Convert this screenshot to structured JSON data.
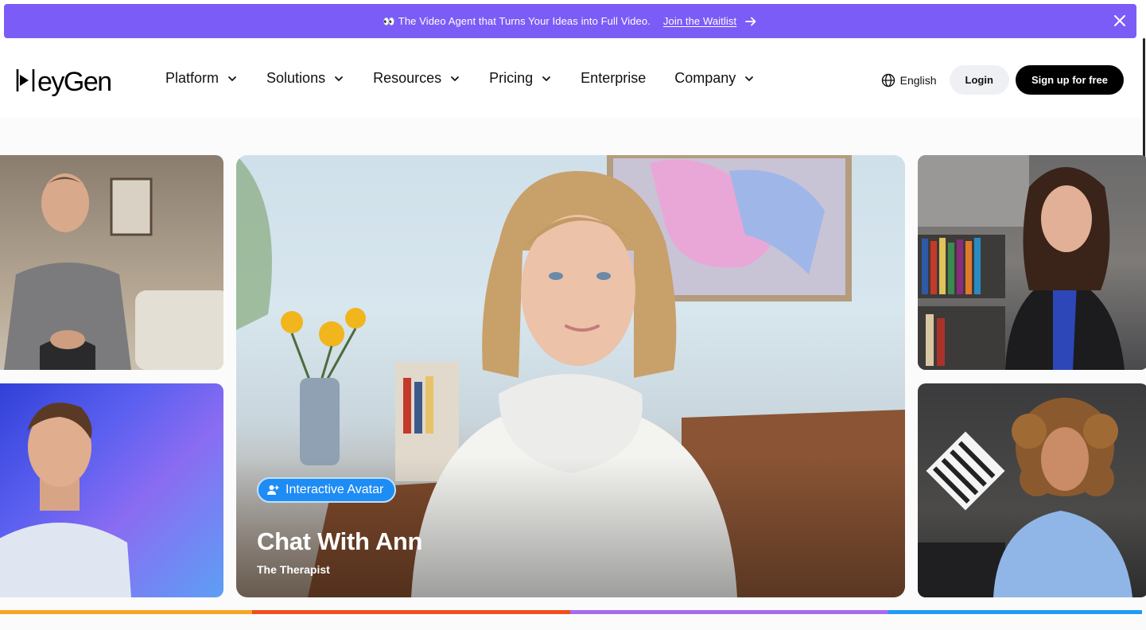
{
  "banner": {
    "emoji": "👀",
    "message": "The Video Agent that Turns Your Ideas into Full Video.",
    "link_label": "Join the Waitlist",
    "bg_color": "#7c5cf6"
  },
  "nav": {
    "logo_text": "HeyGen",
    "menu": [
      {
        "label": "Platform",
        "has_dropdown": true
      },
      {
        "label": "Solutions",
        "has_dropdown": true
      },
      {
        "label": "Resources",
        "has_dropdown": true
      },
      {
        "label": "Pricing",
        "has_dropdown": true
      },
      {
        "label": "Enterprise",
        "has_dropdown": false
      },
      {
        "label": "Company",
        "has_dropdown": true
      }
    ],
    "language": "English",
    "login_label": "Login",
    "signup_label": "Sign up for free"
  },
  "hero": {
    "badge_label": "Interactive Avatar",
    "title": "Chat With Ann",
    "subtitle": "The Therapist",
    "badge_color": "#1e8cf5"
  },
  "progress_segments": [
    {
      "color": "#f6a623"
    },
    {
      "color": "#f04e1c"
    },
    {
      "color": "#a46af2"
    },
    {
      "color": "#1e9bf5"
    }
  ]
}
